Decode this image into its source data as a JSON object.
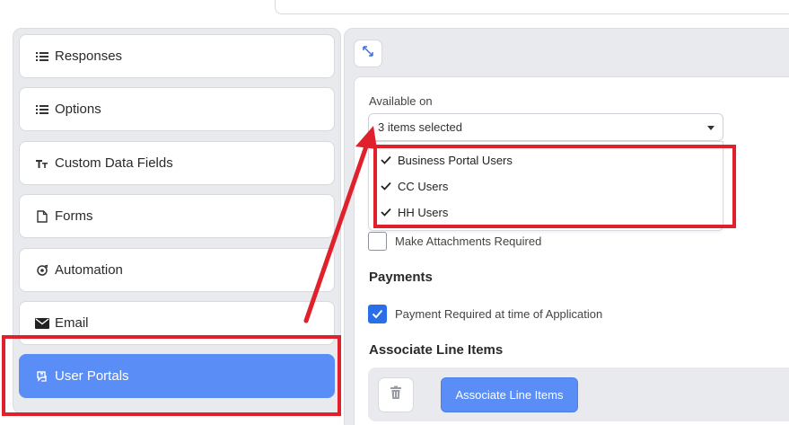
{
  "sidebar": {
    "items": [
      {
        "label": "Responses",
        "icon": "list-icon"
      },
      {
        "label": "Options",
        "icon": "list-icon"
      },
      {
        "label": "Custom Data Fields",
        "icon": "text-format-icon"
      },
      {
        "label": "Forms",
        "icon": "document-icon"
      },
      {
        "label": "Automation",
        "icon": "automation-icon"
      },
      {
        "label": "Email",
        "icon": "envelope-icon"
      },
      {
        "label": "User Portals",
        "icon": "portal-icon",
        "active": true
      }
    ]
  },
  "main": {
    "available_on": {
      "label": "Available on",
      "selected_text": "3 items selected",
      "options": [
        {
          "label": "Business Portal Users",
          "checked": true
        },
        {
          "label": "CC Users",
          "checked": true
        },
        {
          "label": "HH Users",
          "checked": true
        }
      ]
    },
    "attachments_required": {
      "label": "Make Attachments Required",
      "checked": false
    },
    "payments": {
      "heading": "Payments",
      "payment_required": {
        "label": "Payment Required at time of Application",
        "checked": true
      }
    },
    "line_items": {
      "heading": "Associate Line Items",
      "button_label": "Associate Line Items"
    }
  },
  "colors": {
    "accent": "#5b8df6",
    "checkbox": "#2a6ee8",
    "annotation": "#e0202a",
    "panel_bg": "#e9eaee"
  }
}
